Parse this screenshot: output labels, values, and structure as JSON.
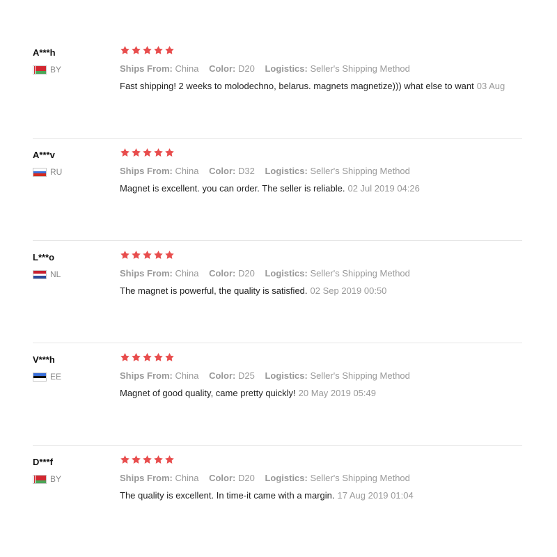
{
  "labels": {
    "ships_from": "Ships From:",
    "color": "Color:",
    "logistics": "Logistics:"
  },
  "colors": {
    "star": "#e84d4d",
    "muted_text": "#999999",
    "divider": "#e6e6e6"
  },
  "reviews": [
    {
      "user": "A***h",
      "country": "BY",
      "flag_icon": "belarus-flag-icon",
      "rating": 5,
      "ships_from": "China",
      "color": "D20",
      "logistics": "Seller's Shipping Method",
      "feedback": "Fast shipping! 2 weeks to molodechno, belarus. magnets magnetize))) what else to want",
      "date": "03 Aug"
    },
    {
      "user": "A***v",
      "country": "RU",
      "flag_icon": "russia-flag-icon",
      "rating": 5,
      "ships_from": "China",
      "color": "D32",
      "logistics": "Seller's Shipping Method",
      "feedback": "Magnet is excellent. you can order. The seller is reliable.",
      "date": "02 Jul 2019 04:26"
    },
    {
      "user": "L***o",
      "country": "NL",
      "flag_icon": "netherlands-flag-icon",
      "rating": 5,
      "ships_from": "China",
      "color": "D20",
      "logistics": "Seller's Shipping Method",
      "feedback": "The magnet is powerful, the quality is satisfied.",
      "date": "02 Sep 2019 00:50"
    },
    {
      "user": "V***h",
      "country": "EE",
      "flag_icon": "estonia-flag-icon",
      "rating": 5,
      "ships_from": "China",
      "color": "D25",
      "logistics": "Seller's Shipping Method",
      "feedback": "Magnet of good quality, came pretty quickly!",
      "date": "20 May 2019 05:49"
    },
    {
      "user": "D***f",
      "country": "BY",
      "flag_icon": "belarus-flag-icon",
      "rating": 5,
      "ships_from": "China",
      "color": "D20",
      "logistics": "Seller's Shipping Method",
      "feedback": "The quality is excellent. In time-it came with a margin.",
      "date": "17 Aug 2019 01:04"
    }
  ]
}
